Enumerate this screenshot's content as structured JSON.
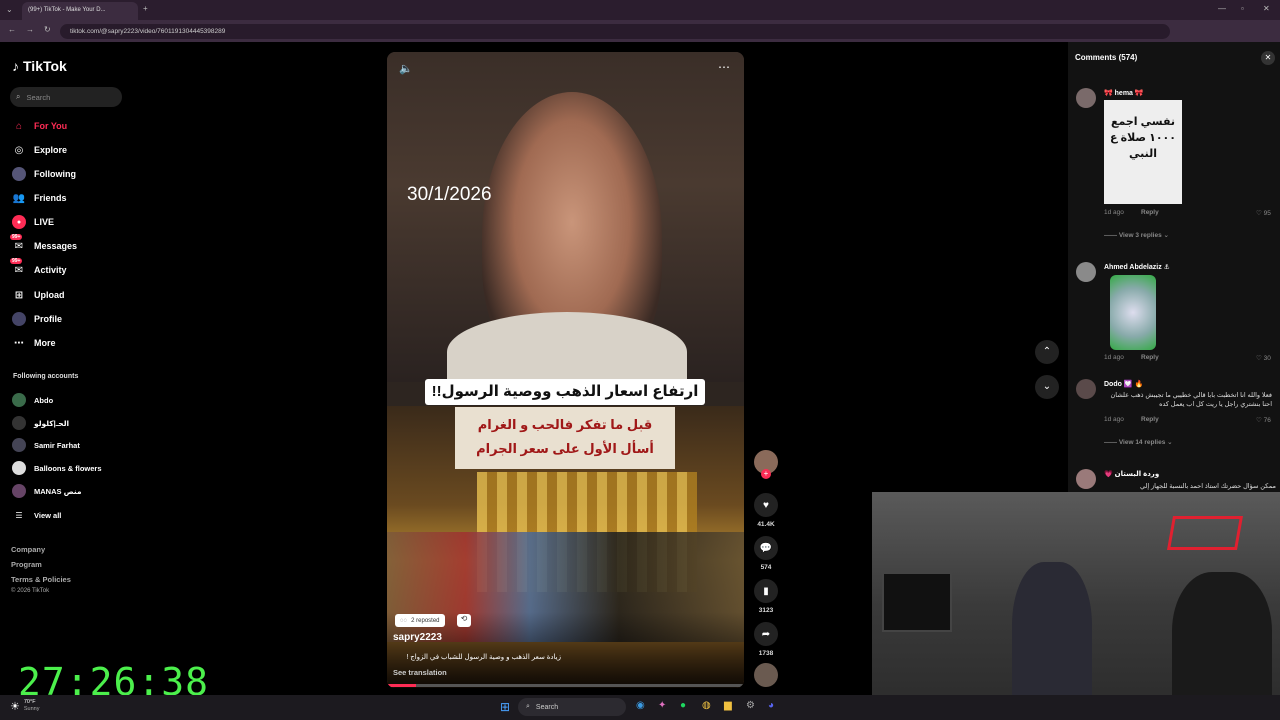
{
  "browser": {
    "tab_title": "(99+) TikTok - Make Your D...",
    "url": "tiktok.com/@sapry2223/video/7601191304445398289"
  },
  "sidebar": {
    "logo": "TikTok",
    "search_placeholder": "Search",
    "nav": [
      {
        "label": "For You",
        "icon": "home-icon"
      },
      {
        "label": "Explore",
        "icon": "compass-icon"
      },
      {
        "label": "Following",
        "icon": "following-icon"
      },
      {
        "label": "Friends",
        "icon": "friends-icon"
      },
      {
        "label": "LIVE",
        "icon": "live-icon"
      },
      {
        "label": "Messages",
        "icon": "messages-icon",
        "badge": "99+"
      },
      {
        "label": "Activity",
        "icon": "activity-icon",
        "badge": "99+"
      },
      {
        "label": "Upload",
        "icon": "upload-icon"
      },
      {
        "label": "Profile",
        "icon": "profile-icon"
      },
      {
        "label": "More",
        "icon": "more-icon"
      }
    ],
    "following_title": "Following accounts",
    "accounts": [
      "Abdo",
      "الحـ|كلولو",
      "Samir Farhat",
      "Balloons & flowers",
      "MANAS منص"
    ],
    "view_all": "View all",
    "footer": [
      "Company",
      "Program",
      "Terms & Policies",
      "© 2026 TikTok"
    ]
  },
  "video": {
    "date_overlay": "30/1/2026",
    "headline": "ارتفاع اسعار الذهب ووصية الرسول!!",
    "sign_line1": "قبل ما تفكر فالحب و الغرام",
    "sign_line2": "أسأل الأول على سعر الجرام",
    "reposted": "2 reposted",
    "username": "sapry2223",
    "caption": "زيادة سعر الذهب و وصية الرسول للشباب في الزواج !",
    "see_translation": "See translation"
  },
  "actions": {
    "likes": "41.4K",
    "comments": "574",
    "saves": "3123",
    "shares": "1738"
  },
  "comments": {
    "title": "Comments",
    "count": "(574)",
    "items": [
      {
        "name": "🎀 hema 🎀",
        "meta": "1d ago",
        "reply": "Reply",
        "likes": "95",
        "replies": "View 3 replies",
        "sticker_text": "نفسي اجمع ١٠٠٠ صلاة ع النبي"
      },
      {
        "name": "Ahmed Abdelaziz ⚓",
        "meta": "1d ago",
        "reply": "Reply",
        "likes": "30"
      },
      {
        "name": "Dodo 💟 🔥",
        "text": "فعلا والله انا اتخطبت بابا قالي خطيبي ما تجيبش ذهب علشان احنا بنشتري راجل يا ريت كل اب يعمل كده",
        "meta": "1d ago",
        "reply": "Reply",
        "likes": "76",
        "replies": "View 14 replies"
      },
      {
        "name": "وردة البستان 💗",
        "text": "ممكن سؤال حضرتك استاذ احمد بالنسبة للجهاز إلي"
      }
    ]
  },
  "overlay": {
    "timer": "27:26:38"
  },
  "taskbar": {
    "weather_temp": "70°F",
    "weather_desc": "Sunny",
    "search_label": "Search"
  }
}
